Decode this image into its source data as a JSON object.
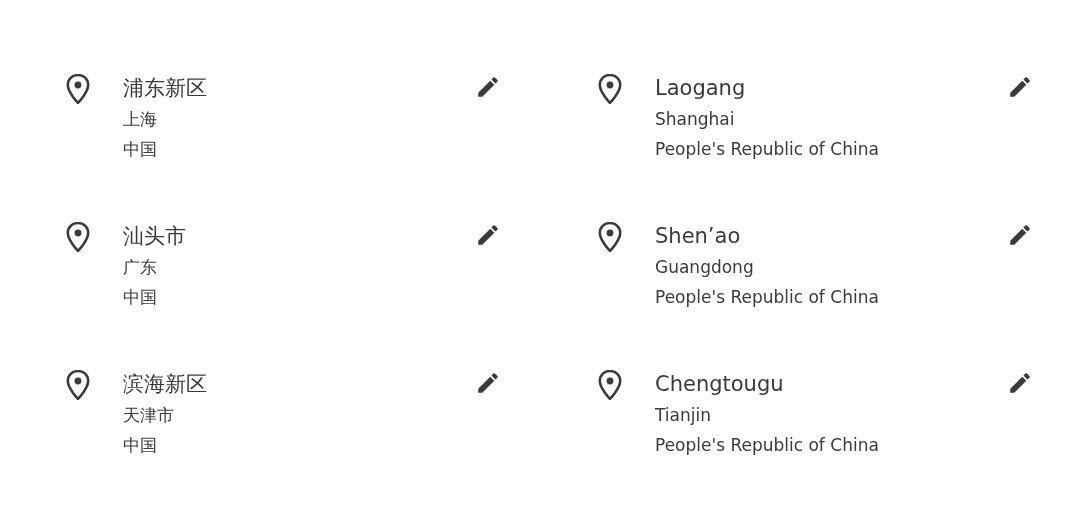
{
  "addresses": [
    {
      "name": "浦东新区",
      "region": "上海",
      "country": "中国"
    },
    {
      "name": "Laogang",
      "region": "Shanghai",
      "country": "People's Republic of China"
    },
    {
      "name": "汕头市",
      "region": "广东",
      "country": "中国"
    },
    {
      "name": "Shen’ao",
      "region": "Guangdong",
      "country": "People's Republic of China"
    },
    {
      "name": "滨海新区",
      "region": "天津市",
      "country": "中国"
    },
    {
      "name": "Chengtougu",
      "region": "Tianjin",
      "country": "People's Republic of China"
    }
  ]
}
